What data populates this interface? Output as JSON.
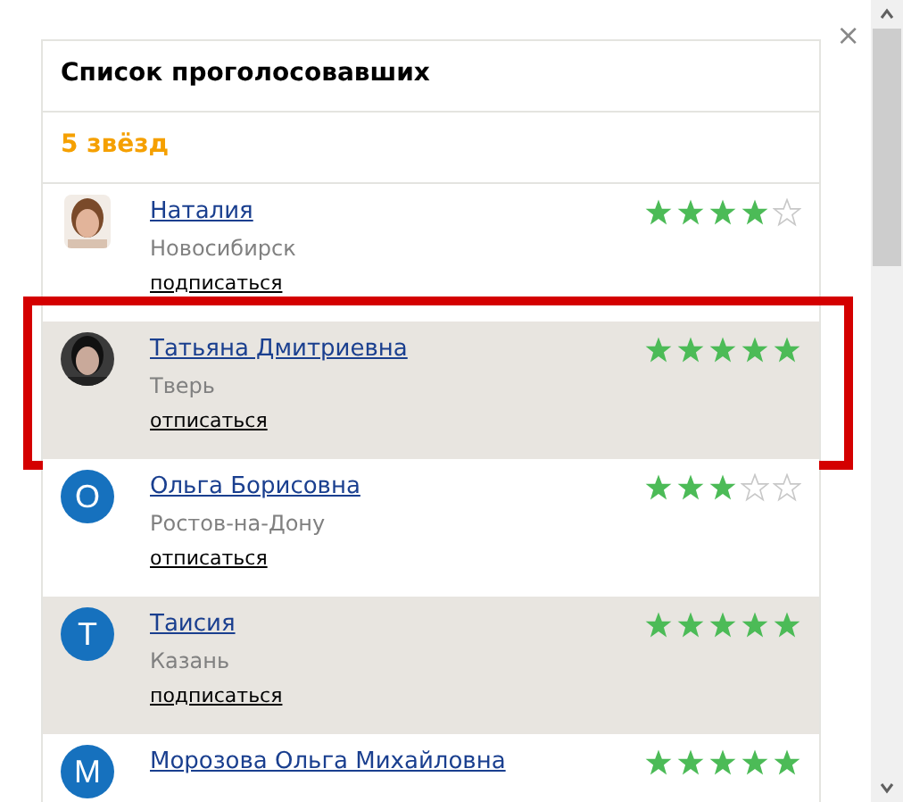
{
  "close_label": "×",
  "title": "Список проголосовавших",
  "group_heading": "5 звёзд",
  "voters": [
    {
      "name": "Наталия",
      "city": "Новосибирск",
      "action": "подписаться",
      "stars": 4,
      "shaded": false,
      "highlighted": false
    },
    {
      "name": "Татьяна Дмитриевна",
      "city": "Тверь",
      "action": "отписаться",
      "stars": 5,
      "shaded": true,
      "highlighted": true
    },
    {
      "name": "Ольга Борисовна",
      "city": "Ростов-на-Дону",
      "action": "отписаться",
      "stars": 3,
      "shaded": false,
      "highlighted": false,
      "avatar": {
        "kind": "letter",
        "letter": "О"
      }
    },
    {
      "name": "Таисия",
      "city": "Казань",
      "action": "подписаться",
      "stars": 5,
      "shaded": true,
      "highlighted": false,
      "avatar": {
        "kind": "letter",
        "letter": "Т"
      }
    },
    {
      "name": "Морозова Ольга Михайловна",
      "stars": 5,
      "shaded": false,
      "highlighted": false,
      "avatar": {
        "kind": "letter",
        "letter": "М"
      }
    }
  ]
}
